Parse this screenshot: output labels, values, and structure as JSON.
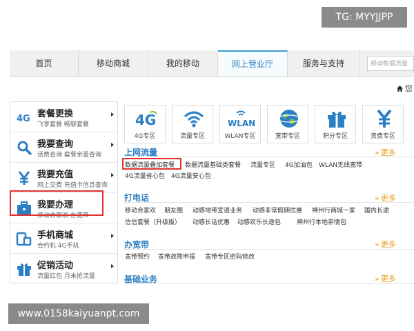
{
  "watermark_top": "TG: MYYJJPP",
  "watermark_bottom": "www.0158kaiyuanpt.com",
  "nav": {
    "items": [
      "首页",
      "移动商城",
      "我的移动",
      "网上营业厅",
      "服务与支持"
    ],
    "search_placeholder": "移动数据流量"
  },
  "breadcrumb": {
    "home_text": "您"
  },
  "left_menu": [
    {
      "title": "套餐更换",
      "sub": "飞享套餐  畅聊套餐",
      "icon": "4g-icon"
    },
    {
      "title": "我要查询",
      "sub": "话费查询  套餐余量查询",
      "icon": "search-icon"
    },
    {
      "title": "我要充值",
      "sub": "网上交费  充值卡信息查询",
      "icon": "yen-icon"
    },
    {
      "title": "我要办理",
      "sub": "移动合家欢  办宽带",
      "icon": "briefcase-icon"
    },
    {
      "title": "手机商城",
      "sub": "合约机  4G手机",
      "icon": "phone-icon"
    },
    {
      "title": "促销活动",
      "sub": "流量红包  月末抢流量",
      "icon": "gift-icon"
    }
  ],
  "tiles": [
    {
      "label": "4G专区"
    },
    {
      "label": "流量专区"
    },
    {
      "label": "WLAN专区"
    },
    {
      "label": "宽带专区"
    },
    {
      "label": "积分专区"
    },
    {
      "label": "资费专区"
    }
  ],
  "tile_icon_texts": {
    "fourg": "4G",
    "wlan": "WLAN"
  },
  "sections": {
    "more": "更多",
    "s1": {
      "title": "上网流量",
      "row1": [
        "数据流量叠加套餐",
        "数据流量基础类套餐",
        "流量专区",
        "4G加油包",
        "WLAN无线宽带"
      ],
      "row2": [
        "4G流量省心包",
        "4G流量安心包"
      ]
    },
    "s2": {
      "title": "打电话",
      "row1": [
        "移动合家欢",
        "朋友圈",
        "动感地带宣语业务",
        "动感非常假期优惠",
        "神州行两城一家",
        "国内长途"
      ],
      "row2": [
        "信信套餐（升级版）",
        "动感长话优惠",
        "动感欢乐长途包",
        "神州行本地亲情包"
      ]
    },
    "s3": {
      "title": "办宽带",
      "row1": [
        "宽带预约",
        "宽带故障申报",
        "宽带专区密码修改"
      ]
    },
    "s4": {
      "title": "基础业务"
    }
  },
  "colors": {
    "accent": "#2b7fc4",
    "highlight": "#e03030",
    "more": "#e8a020"
  }
}
